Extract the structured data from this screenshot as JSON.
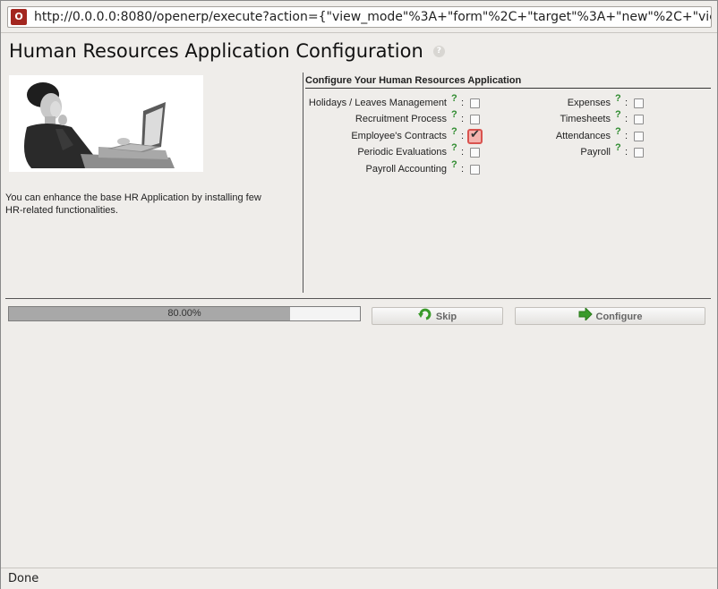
{
  "browser": {
    "site_icon_letter": "O",
    "url": "http://0.0.0.0:8080/openerp/execute?action={\"view_mode\"%3A+\"form\"%2C+\"target\"%3A+\"new\"%2C+\"view_ty"
  },
  "page": {
    "title": "Human Resources Application Configuration",
    "title_help_icon": "question-bubble-icon"
  },
  "left_panel": {
    "image": "man-with-laptop-photo",
    "intro_text": "You can enhance the base HR Application by installing few HR-related functionalities."
  },
  "form": {
    "section_title": "Configure Your Human Resources Application",
    "help_mark": "?",
    "colon": ":",
    "left_fields": [
      {
        "label": "Holidays / Leaves Management",
        "checked": false
      },
      {
        "label": "Recruitment Process",
        "checked": false
      },
      {
        "label": "Employee's Contracts",
        "checked": true
      },
      {
        "label": "Periodic Evaluations",
        "checked": false
      },
      {
        "label": "Payroll Accounting",
        "checked": false
      }
    ],
    "right_fields": [
      {
        "label": "Expenses",
        "checked": false
      },
      {
        "label": "Timesheets",
        "checked": false
      },
      {
        "label": "Attendances",
        "checked": false
      },
      {
        "label": "Payroll",
        "checked": false
      }
    ]
  },
  "footer": {
    "progress_value": 0.8,
    "progress_text": "80.00%",
    "skip_label": "Skip",
    "skip_icon": "green-rotate-arrow-icon",
    "configure_label": "Configure",
    "configure_icon": "green-right-arrow-icon"
  },
  "status_bar": {
    "text": "Done"
  },
  "colors": {
    "help_green": "#2e8b2e",
    "checked_red": "#d9534f",
    "progress_fill": "#a8a8a8",
    "site_icon_red": "#a3261f"
  }
}
